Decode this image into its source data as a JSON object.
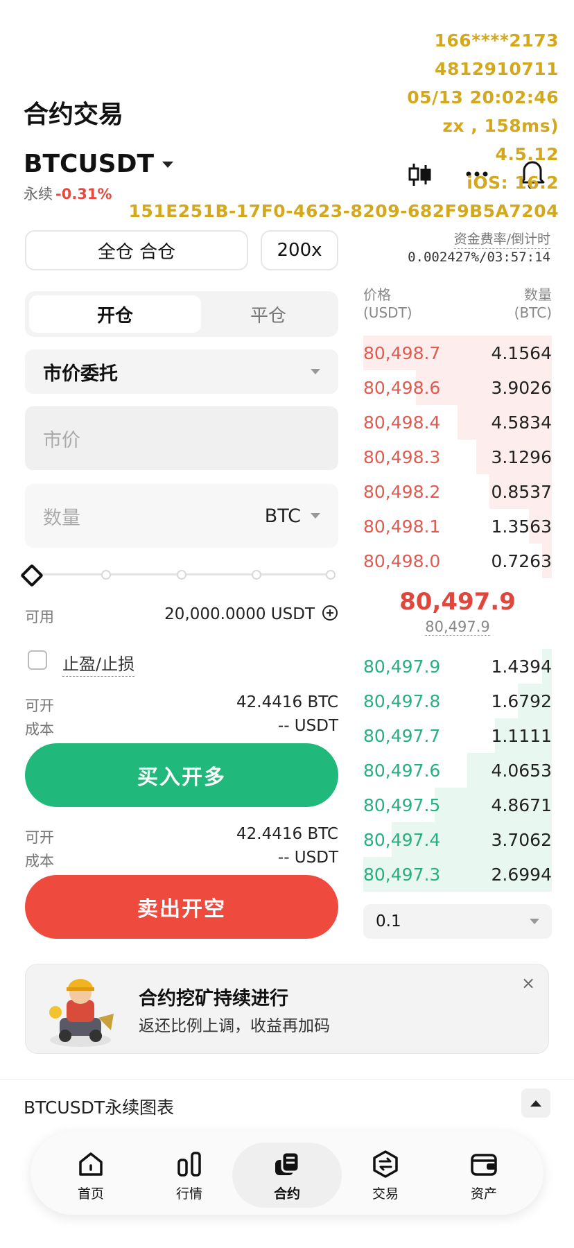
{
  "watermark": {
    "phone": "166****2173",
    "id": "4812910711",
    "datetime": "05/13 20:02:46",
    "latency": "zx , 158ms)",
    "version": "4.5.12",
    "os": "iOS: 16.2",
    "uuid": "151E251B-17F0-4623-8209-682F9B5A7204"
  },
  "header": {
    "title": "合约交易",
    "pair": "BTCUSDT",
    "contract_type": "永续",
    "change": "-0.31%"
  },
  "icons": {
    "candle": "candlestick-icon",
    "more": "more-dots-icon",
    "bell": "bell-icon"
  },
  "margin": {
    "mode_label": "全仓 合仓",
    "leverage": "200x"
  },
  "funding": {
    "label": "资金费率/倒计时",
    "value": "0.002427%/03:57:14"
  },
  "tabs": {
    "open": "开仓",
    "close": "平仓"
  },
  "order_type": "市价委托",
  "price_input": {
    "placeholder": "市价"
  },
  "qty_input": {
    "placeholder": "数量",
    "unit": "BTC"
  },
  "available": {
    "label": "可用",
    "value": "20,000.0000 USDT"
  },
  "tpsl_label": "止盈/止损",
  "buy_info": {
    "open_label": "可开",
    "open_value": "42.4416 BTC",
    "cost_label": "成本",
    "cost_value": "-- USDT"
  },
  "buy_button": "买入开多",
  "sell_info": {
    "open_label": "可开",
    "open_value": "42.4416 BTC",
    "cost_label": "成本",
    "cost_value": "-- USDT"
  },
  "sell_button": "卖出开空",
  "orderbook": {
    "price_header": "价格",
    "price_unit": "(USDT)",
    "qty_header": "数量",
    "qty_unit": "(BTC)",
    "asks": [
      {
        "price": "80,498.7",
        "qty": "4.1564",
        "depth": 1.0
      },
      {
        "price": "80,498.6",
        "qty": "3.9026",
        "depth": 0.72
      },
      {
        "price": "80,498.4",
        "qty": "4.5834",
        "depth": 0.5
      },
      {
        "price": "80,498.3",
        "qty": "3.1296",
        "depth": 0.4
      },
      {
        "price": "80,498.2",
        "qty": "0.8537",
        "depth": 0.33
      },
      {
        "price": "80,498.1",
        "qty": "1.3563",
        "depth": 0.12
      },
      {
        "price": "80,498.0",
        "qty": "0.7263",
        "depth": 0.05
      }
    ],
    "last_price": "80,497.9",
    "mark_price": "80,497.9",
    "bids": [
      {
        "price": "80,497.9",
        "qty": "1.4394",
        "depth": 0.05
      },
      {
        "price": "80,497.8",
        "qty": "1.6792",
        "depth": 0.18
      },
      {
        "price": "80,497.7",
        "qty": "1.1111",
        "depth": 0.3
      },
      {
        "price": "80,497.6",
        "qty": "4.0653",
        "depth": 0.45
      },
      {
        "price": "80,497.5",
        "qty": "4.8671",
        "depth": 0.62
      },
      {
        "price": "80,497.4",
        "qty": "3.7062",
        "depth": 0.85
      },
      {
        "price": "80,497.3",
        "qty": "2.6994",
        "depth": 1.0
      }
    ],
    "depth_step": "0.1"
  },
  "banner": {
    "title": "合约挖矿持续进行",
    "subtitle": "返还比例上调，收益再加码",
    "close": "×"
  },
  "chart_bar": {
    "title": "BTCUSDT永续图表"
  },
  "nav": {
    "items": [
      {
        "label": "首页"
      },
      {
        "label": "行情"
      },
      {
        "label": "合约"
      },
      {
        "label": "交易"
      },
      {
        "label": "资产"
      }
    ]
  },
  "colors": {
    "buy": "#20b97b",
    "sell": "#ee4a3e",
    "watermark": "#d4a81c"
  }
}
